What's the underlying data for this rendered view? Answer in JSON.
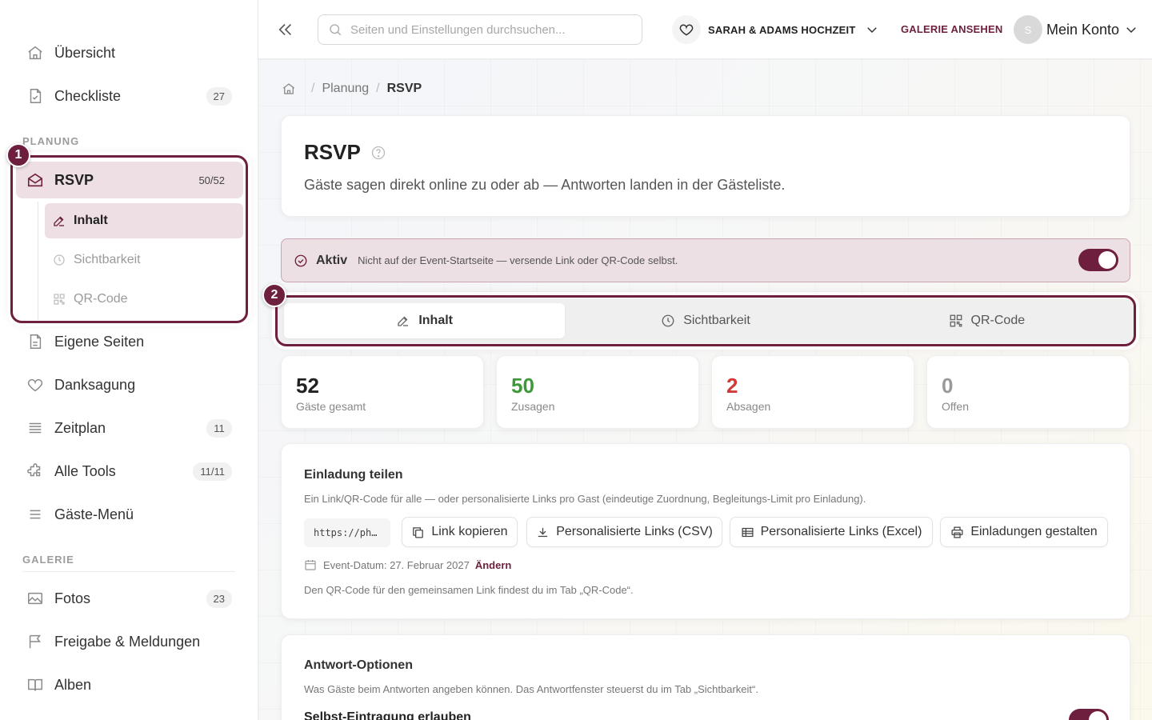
{
  "sidebar": {
    "items_top": [
      {
        "label": "Übersicht",
        "badge": null
      },
      {
        "label": "Checkliste",
        "badge": "27"
      }
    ],
    "section_planung": "PLANUNG",
    "rsvp": {
      "label": "RSVP",
      "badge": "50/52"
    },
    "rsvp_sub": [
      {
        "label": "Inhalt"
      },
      {
        "label": "Sichtbarkeit"
      },
      {
        "label": "QR-Code"
      }
    ],
    "items_planung": [
      {
        "label": "Eigene Seiten",
        "badge": null
      },
      {
        "label": "Danksagung",
        "badge": null
      },
      {
        "label": "Zeitplan",
        "badge": "11"
      },
      {
        "label": "Alle Tools",
        "badge": "11/11"
      },
      {
        "label": "Gäste-Menü",
        "badge": null
      }
    ],
    "section_galerie": "GALERIE",
    "items_galerie": [
      {
        "label": "Fotos",
        "badge": "23"
      },
      {
        "label": "Freigabe & Meldungen",
        "badge": null
      },
      {
        "label": "Alben",
        "badge": null
      }
    ]
  },
  "markers": [
    "1",
    "2"
  ],
  "topbar": {
    "search_placeholder": "Seiten und Einstellungen durchsuchen...",
    "event_name": "SARAH & ADAMS HOCHZEIT",
    "gallery_link": "GALERIE ANSEHEN",
    "avatar_initial": "S",
    "account_label": "Mein Konto"
  },
  "breadcrumb": [
    "Planung",
    "RSVP"
  ],
  "header": {
    "title": "RSVP",
    "subtitle": "Gäste sagen direkt online zu oder ab — Antworten landen in der Gästeliste."
  },
  "status": {
    "state": "Aktiv",
    "note": "Nicht auf der Event-Startseite — versende Link oder QR-Code selbst.",
    "enabled": true
  },
  "tabs": [
    {
      "label": "Inhalt",
      "active": true
    },
    {
      "label": "Sichtbarkeit",
      "active": false
    },
    {
      "label": "QR-Code",
      "active": false
    }
  ],
  "stats": [
    {
      "value": "52",
      "label": "Gäste gesamt",
      "color": "#222222"
    },
    {
      "value": "50",
      "label": "Zusagen",
      "color": "#3d9a3a"
    },
    {
      "value": "2",
      "label": "Absagen",
      "color": "#d23a3a"
    },
    {
      "value": "0",
      "label": "Offen",
      "color": "#9a9a9a"
    }
  ],
  "share": {
    "title": "Einladung teilen",
    "description": "Ein Link/QR-Code für alle — oder personalisierte Links pro Gast (eindeutige Zuordnung, Begleitungs-Limit pro Einladung).",
    "url_preview": "https://ph…",
    "buttons": {
      "copy": "Link kopieren",
      "csv": "Personalisierte Links (CSV)",
      "excel": "Personalisierte Links (Excel)",
      "design": "Einladungen gestalten"
    },
    "event_date": "Event-Datum: 27. Februar 2027",
    "change_label": "Ändern",
    "hint": "Den QR-Code für den gemeinsamen Link findest du im Tab „QR-Code“."
  },
  "options": {
    "title": "Antwort-Optionen",
    "description": "Was Gäste beim Antworten angeben können. Das Antwortfenster steuerst du im Tab „Sichtbarkeit“.",
    "first_option": "Selbst-Eintragung erlauben"
  },
  "colors": {
    "accent": "#6e1f3d",
    "accent_soft": "#eddfe3"
  }
}
